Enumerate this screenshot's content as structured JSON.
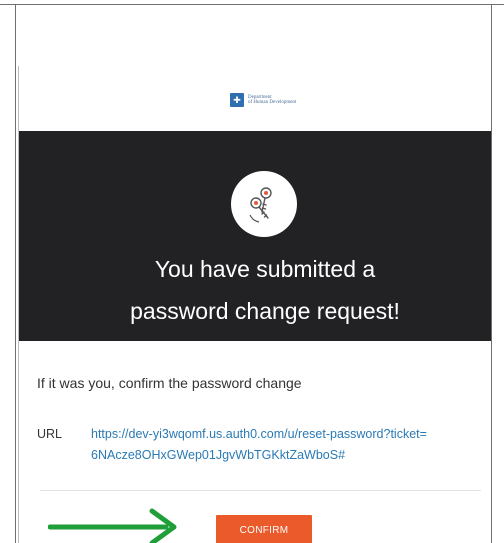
{
  "logo": {
    "mark": "✚",
    "text": "Department\nof Human Development"
  },
  "hero": {
    "title_line1": "You have submitted a",
    "title_line2": "password change request!"
  },
  "lead_text": "If it was you, confirm the password change",
  "url": {
    "label": "URL",
    "line1": "https://dev-yi3wqomf.us.auth0.com/u/reset-password?ticket=",
    "line2": "6NAcze8OHxGWep01JgvWbTGKktZaWboS#"
  },
  "confirm_button": {
    "label": "CONFIRM"
  },
  "colors": {
    "hero_background": "#222225",
    "link": "#2a7ab5",
    "button": "#ea5a2b",
    "arrow": "#1f9e3a"
  },
  "icons": {
    "hero_icon": "keys-icon",
    "annotation": "green-arrow-icon"
  }
}
